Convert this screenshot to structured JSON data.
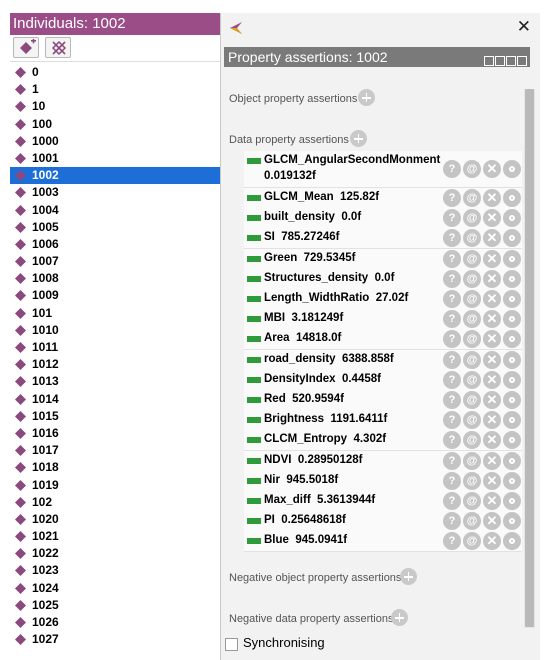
{
  "individuals_panel": {
    "title": "Individuals: 1002",
    "toolbar": [
      {
        "icon": "add-individual-icon"
      },
      {
        "icon": "delete-individual-icon"
      }
    ],
    "items": [
      "0",
      "1",
      "10",
      "100",
      "1000",
      "1001",
      "1002",
      "1003",
      "1004",
      "1005",
      "1006",
      "1007",
      "1008",
      "1009",
      "101",
      "1010",
      "1011",
      "1012",
      "1013",
      "1014",
      "1015",
      "1016",
      "1017",
      "1018",
      "1019",
      "102",
      "1020",
      "1021",
      "1022",
      "1023",
      "1024",
      "1025",
      "1026",
      "1027"
    ],
    "selected": "1002"
  },
  "assertions_panel": {
    "close_label": "✕",
    "title": "Property assertions: 1002",
    "sections": {
      "object_property": "Object property assertions",
      "data_property": "Data property assertions",
      "negative_object_property": "Negative object property assertions",
      "negative_data_property": "Negative data property assertions"
    },
    "data_assertions": [
      {
        "name": "GLCM_AngularSecondMonment",
        "value": "0.019132f"
      },
      {
        "name": "GLCM_Mean",
        "value": "125.82f"
      },
      {
        "name": "built_density",
        "value": "0.0f"
      },
      {
        "name": "SI",
        "value": "785.27246f"
      },
      {
        "name": "Green",
        "value": "729.5345f"
      },
      {
        "name": "Structures_density",
        "value": "0.0f"
      },
      {
        "name": "Length_WidthRatio",
        "value": "27.02f"
      },
      {
        "name": "MBI",
        "value": "3.181249f"
      },
      {
        "name": "Area",
        "value": "14818.0f"
      },
      {
        "name": "road_density",
        "value": "6388.858f"
      },
      {
        "name": "DensityIndex",
        "value": "0.4458f"
      },
      {
        "name": "Red",
        "value": "520.9594f"
      },
      {
        "name": "Brightness",
        "value": "1191.6411f"
      },
      {
        "name": "CLCM_Entropy",
        "value": "4.302f"
      },
      {
        "name": "NDVI",
        "value": "0.28950128f"
      },
      {
        "name": "Nir",
        "value": "945.5018f"
      },
      {
        "name": "Max_diff",
        "value": "5.3613944f"
      },
      {
        "name": "PI",
        "value": "0.25648618f"
      },
      {
        "name": "Blue",
        "value": "945.0941f"
      }
    ],
    "row_button_labels": {
      "explain": "?",
      "annotate": "@",
      "delete": "✕"
    },
    "synchronising": {
      "label": "Synchronising",
      "checked": false
    }
  },
  "colors": {
    "individuals_title_bg": "#9a4d86",
    "individual_icon": "#8b4a7e",
    "selection": "#1d6ed6",
    "assertions_header_bg": "#7a7a7a",
    "data_property_swatch": "#2e9a3a"
  }
}
